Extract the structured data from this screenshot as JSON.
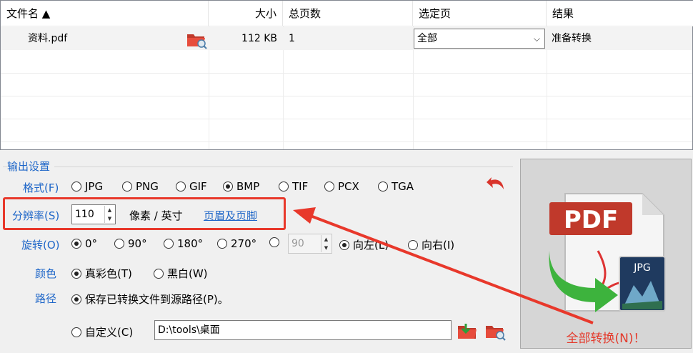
{
  "table": {
    "headers": [
      "文件名 ▲",
      "大小",
      "总页数",
      "选定页",
      "结果"
    ],
    "rows": [
      {
        "name": "资料.pdf",
        "size": "112 KB",
        "pages": "1",
        "selected": "全部",
        "result": "准备转换"
      }
    ]
  },
  "output": {
    "title": "输出设置",
    "format": {
      "label": "格式(F)",
      "options": [
        "JPG",
        "PNG",
        "GIF",
        "BMP",
        "TIF",
        "PCX",
        "TGA"
      ],
      "selected": "BMP"
    },
    "resolution": {
      "label": "分辨率(S)",
      "value": "110",
      "unit": "像素 / 英寸",
      "link": "页眉及页脚"
    },
    "rotation": {
      "label": "旋转(O)",
      "options": [
        "0°",
        "90°",
        "180°",
        "270°"
      ],
      "custom_value": "90",
      "dir_left": "向左(L)",
      "dir_right": "向右(I)"
    },
    "color": {
      "label": "颜色",
      "options": [
        "真彩色(T)",
        "黑白(W)"
      ]
    },
    "path": {
      "label": "路径",
      "keep_source": "保存已转换文件到源路径(P)。",
      "custom_label": "自定义(C)",
      "custom_value": "D:\\tools\\桌面"
    }
  },
  "convert_all": {
    "label": "全部转换(N)！",
    "pdf_text": "PDF",
    "jpg_text": "JPG"
  },
  "colors": {
    "accent": "#1e66c8",
    "annotation": "#e8382b"
  }
}
